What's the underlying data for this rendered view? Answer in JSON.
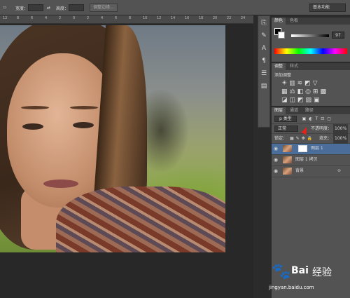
{
  "options_bar": {
    "width_label": "宽度：",
    "height_label": "高度：",
    "adjust_edge_button": "调整边缘...",
    "workspace": "基本功能"
  },
  "ruler_ticks": [
    "12",
    "8",
    "6",
    "4",
    "2",
    "0",
    "2",
    "4",
    "6",
    "8",
    "10",
    "12",
    "14",
    "16",
    "18",
    "20",
    "22",
    "24"
  ],
  "color_panel": {
    "tabs": [
      "颜色",
      "色板"
    ],
    "slider_value": "97"
  },
  "adjust_panel": {
    "tabs": [
      "调整",
      "样式"
    ],
    "title": "添加调整"
  },
  "layers_panel": {
    "tabs": [
      "图层",
      "通道",
      "路径"
    ],
    "filter": "p 类型",
    "blend_mode": "正常",
    "opacity_label": "不透明度：",
    "opacity_value": "100%",
    "lock_label": "锁定：",
    "fill_label": "填充：",
    "fill_value": "100%",
    "layers": [
      {
        "name": "图层 1",
        "selected": true
      },
      {
        "name": "图层 1 拷贝",
        "selected": false
      },
      {
        "name": "背景",
        "selected": false
      }
    ]
  },
  "watermark": {
    "brand": "Bai",
    "brand_cn": "经验",
    "url": "jingyan.baidu.com"
  }
}
